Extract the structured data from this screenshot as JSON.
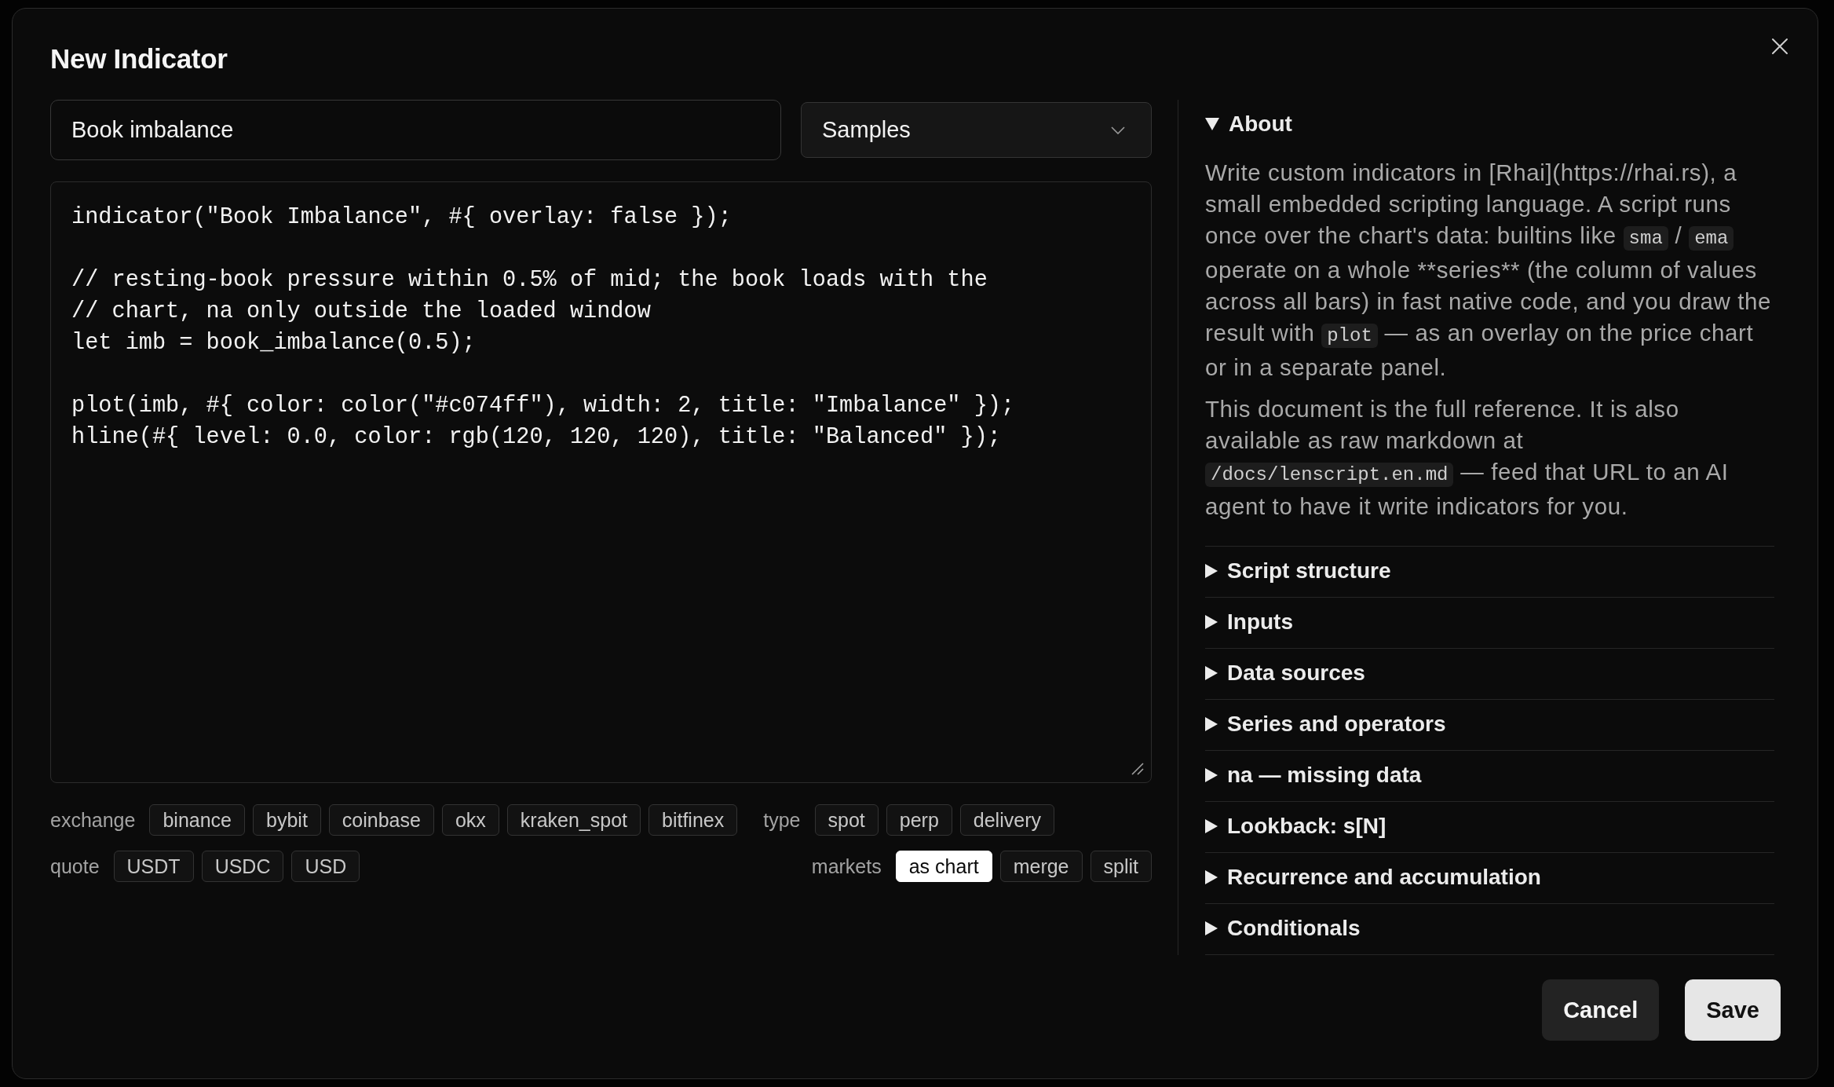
{
  "dialog": {
    "title": "New Indicator"
  },
  "name_field": {
    "value": "Book imbalance"
  },
  "samples_dropdown": {
    "label": "Samples"
  },
  "code_editor": {
    "value": "indicator(\"Book Imbalance\", #{ overlay: false });\n\n// resting-book pressure within 0.5% of mid; the book loads with the\n// chart, na only outside the loaded window\nlet imb = book_imbalance(0.5);\n\nplot(imb, #{ color: color(\"#c074ff\"), width: 2, title: \"Imbalance\" });\nhline(#{ level: 0.0, color: rgb(120, 120, 120), title: \"Balanced\" });"
  },
  "filter_rows": [
    {
      "groups": [
        {
          "label": "exchange",
          "options": [
            {
              "label": "binance",
              "selected": false
            },
            {
              "label": "bybit",
              "selected": false
            },
            {
              "label": "coinbase",
              "selected": false
            },
            {
              "label": "okx",
              "selected": false
            },
            {
              "label": "kraken_spot",
              "selected": false
            },
            {
              "label": "bitfinex",
              "selected": false
            }
          ]
        },
        {
          "label": "type",
          "options": [
            {
              "label": "spot",
              "selected": false
            },
            {
              "label": "perp",
              "selected": false
            },
            {
              "label": "delivery",
              "selected": false
            }
          ]
        }
      ]
    },
    {
      "groups": [
        {
          "label": "quote",
          "options": [
            {
              "label": "USDT",
              "selected": false
            },
            {
              "label": "USDC",
              "selected": false
            },
            {
              "label": "USD",
              "selected": false
            }
          ]
        },
        {
          "label": "markets",
          "options": [
            {
              "label": "as chart",
              "selected": true
            },
            {
              "label": "merge",
              "selected": false
            },
            {
              "label": "split",
              "selected": false
            }
          ]
        }
      ]
    }
  ],
  "docs": {
    "sections": [
      {
        "title": "About",
        "expanded": true,
        "paragraphs": [
          {
            "segments": [
              {
                "kind": "text",
                "text": "Write custom indicators in [Rhai](https://rhai.rs), a small embedded scripting language. A script runs once over the chart's data: builtins like "
              },
              {
                "kind": "code",
                "text": "sma"
              },
              {
                "kind": "text",
                "text": " / "
              },
              {
                "kind": "code",
                "text": "ema"
              },
              {
                "kind": "text",
                "text": " operate on a whole **series** (the column of values across all bars) in fast native code, and you draw the result with "
              },
              {
                "kind": "code",
                "text": "plot"
              },
              {
                "kind": "text",
                "text": " — as an overlay on the price chart or in a separate panel."
              }
            ]
          },
          {
            "segments": [
              {
                "kind": "text",
                "text": "This document is the full reference. It is also available as raw markdown at "
              },
              {
                "kind": "code",
                "text": "/docs/lenscript.en.md"
              },
              {
                "kind": "text",
                "text": " — feed that URL to an AI agent to have it write indicators for you."
              }
            ]
          }
        ]
      },
      {
        "title": "Script structure",
        "expanded": false
      },
      {
        "title": "Inputs",
        "expanded": false
      },
      {
        "title": "Data sources",
        "expanded": false
      },
      {
        "title": "Series and operators",
        "expanded": false
      },
      {
        "title": "na — missing data",
        "expanded": false
      },
      {
        "title": "Lookback: s[N]",
        "expanded": false
      },
      {
        "title": "Recurrence and accumulation",
        "expanded": false
      },
      {
        "title": "Conditionals",
        "expanded": false
      }
    ]
  },
  "buttons": [
    {
      "label": "Cancel",
      "kind": "secondary"
    },
    {
      "label": "Save",
      "kind": "primary"
    }
  ]
}
